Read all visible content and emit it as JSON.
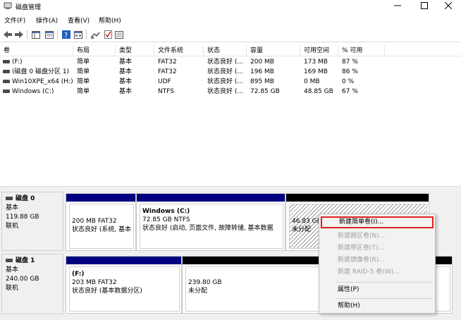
{
  "window": {
    "title": "磁盘管理"
  },
  "menu": [
    "文件(F)",
    "操作(A)",
    "查看(V)",
    "帮助(H)"
  ],
  "toolbar": {
    "icons": [
      "back-arrow-icon",
      "forward-arrow-icon",
      "console-tree-icon",
      "help-icon",
      "properties-icon",
      "connect-icon",
      "check-icon",
      "settings-icon"
    ]
  },
  "columns": [
    "卷",
    "布局",
    "类型",
    "文件系统",
    "状态",
    "容量",
    "可用空间",
    "% 可用"
  ],
  "volumes": [
    {
      "name": "(F:)",
      "layout": "简单",
      "type": "基本",
      "fs": "FAT32",
      "status": "状态良好 (...",
      "capacity": "200 MB",
      "free": "173 MB",
      "pct": "87 %"
    },
    {
      "name": "(磁盘 0 磁盘分区 1)",
      "layout": "简单",
      "type": "基本",
      "fs": "FAT32",
      "status": "状态良好 (...",
      "capacity": "196 MB",
      "free": "169 MB",
      "pct": "86 %"
    },
    {
      "name": "Win10XPE_x64 (H:)",
      "layout": "简单",
      "type": "基本",
      "fs": "UDF",
      "status": "状态良好 (...",
      "capacity": "895 MB",
      "free": "0 MB",
      "pct": "0 %"
    },
    {
      "name": "Windows (C:)",
      "layout": "简单",
      "type": "基本",
      "fs": "NTFS",
      "status": "状态良好 (...",
      "capacity": "72.85 GB",
      "free": "48.85 GB",
      "pct": "67 %"
    }
  ],
  "disks": [
    {
      "name": "磁盘 0",
      "type": "基本",
      "size": "119.88 GB",
      "state": "联机",
      "partitions": [
        {
          "title": "",
          "line1": "200 MB FAT32",
          "line2": "状态良好 (系统, 基本"
        },
        {
          "title": "Windows  (C:)",
          "line1": "72.85 GB NTFS",
          "line2": "状态良好 (启动, 页面文件, 故障转储, 基本数据"
        },
        {
          "title": "",
          "line1": "46.83 GB",
          "line2": "未分配"
        }
      ]
    },
    {
      "name": "磁盘 1",
      "type": "基本",
      "size": "240.00 GB",
      "state": "联机",
      "partitions": [
        {
          "title": "(F:)",
          "line1": "203 MB FAT32",
          "line2": "状态良好 (基本数据分区)"
        },
        {
          "title": "",
          "line1": "239.80 GB",
          "line2": "未分配"
        }
      ]
    }
  ],
  "context_menu": {
    "items": [
      {
        "label": "新建简单卷(I)...",
        "enabled": true,
        "highlighted": true
      },
      {
        "label": "新建跨区卷(N)...",
        "enabled": false
      },
      {
        "label": "新建带区卷(T)...",
        "enabled": false
      },
      {
        "label": "新建镜像卷(R)...",
        "enabled": false
      },
      {
        "label": "新建 RAID-5 卷(W)...",
        "enabled": false
      },
      {
        "label": "属性(P)",
        "enabled": true
      },
      {
        "label": "帮助(H)",
        "enabled": true
      }
    ]
  },
  "colors": {
    "primary_partition": "#000080",
    "unallocated": "#000000",
    "highlight_border": "#e02020"
  }
}
